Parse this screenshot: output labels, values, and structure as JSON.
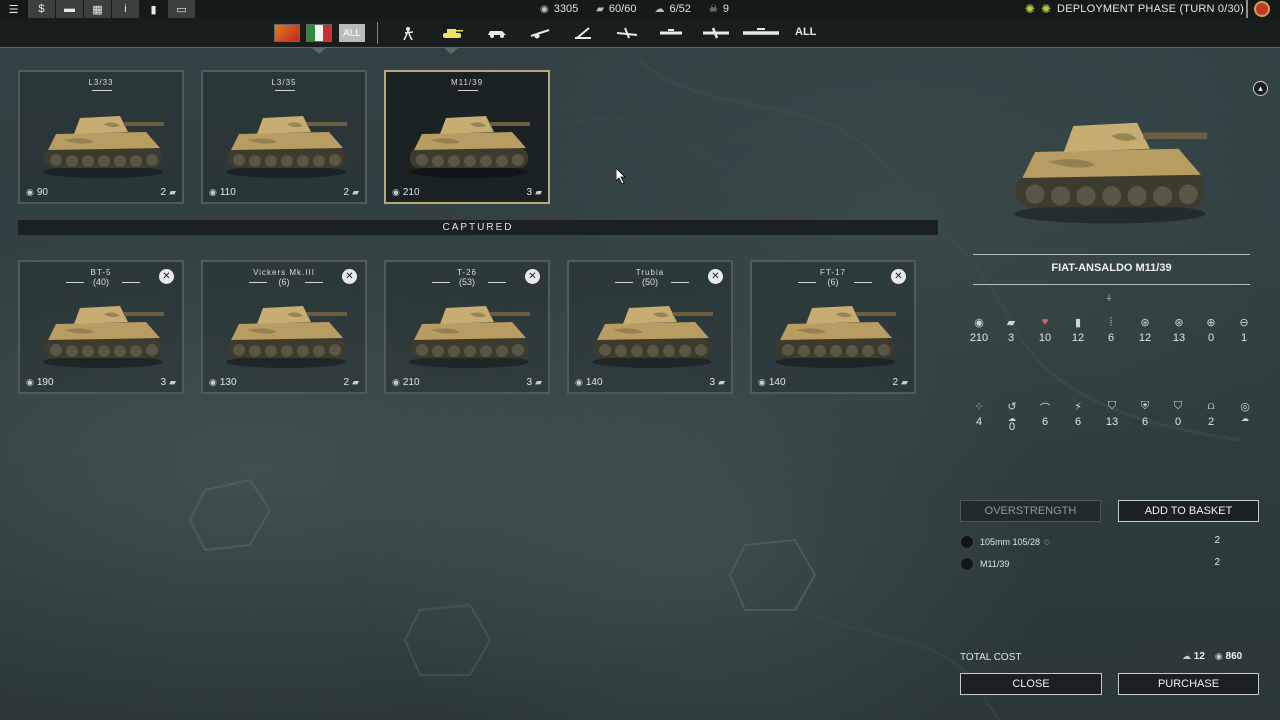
{
  "topbar": {
    "menu_icons": [
      "menu-icon",
      "money-icon",
      "chat-icon",
      "grid-icon",
      "info-icon",
      "stats-icon",
      "minimap-icon"
    ],
    "resources": [
      {
        "icon": "coins-icon",
        "value": "3305"
      },
      {
        "icon": "tank-slots-icon",
        "value": "60/60"
      },
      {
        "icon": "cloud-icon",
        "value": "6/52"
      },
      {
        "icon": "skull-icon",
        "value": "9"
      }
    ],
    "phase": "DEPLOYMENT PHASE (TURN 0/30)"
  },
  "filters": {
    "all_nations": "ALL",
    "all_categories": "ALL",
    "categories": [
      "infantry-icon",
      "tank-icon",
      "armored-car-icon",
      "artillery-icon",
      "anti-air-icon",
      "fighter-icon",
      "tactical-bomber-icon",
      "strategic-bomber-icon",
      "transport-plane-icon"
    ]
  },
  "units": [
    {
      "name": "L3/33",
      "cost": "90",
      "slots": "2"
    },
    {
      "name": "L3/35",
      "cost": "110",
      "slots": "2"
    },
    {
      "name": "M11/39",
      "cost": "210",
      "slots": "3"
    }
  ],
  "captured_label": "CAPTURED",
  "captured": [
    {
      "name": "BT-5",
      "count": "(40)",
      "cost": "190",
      "slots": "3"
    },
    {
      "name": "Vickers Mk.III",
      "count": "(6)",
      "cost": "130",
      "slots": "2"
    },
    {
      "name": "T-26",
      "count": "(53)",
      "cost": "210",
      "slots": "3"
    },
    {
      "name": "Trubia",
      "count": "(50)",
      "cost": "140",
      "slots": "3"
    },
    {
      "name": "FT-17",
      "count": "(6)",
      "cost": "140",
      "slots": "2"
    }
  ],
  "detail": {
    "title": "FIAT-ANSALDO M11/39",
    "stats_row1": [
      {
        "icon": "cost-icon",
        "value": "210"
      },
      {
        "icon": "slots-icon",
        "value": "3"
      },
      {
        "icon": "health-icon",
        "value": "10"
      },
      {
        "icon": "fuel-icon",
        "value": "12"
      },
      {
        "icon": "ammo-icon",
        "value": "6"
      },
      {
        "icon": "soft-attack-icon",
        "value": "12"
      },
      {
        "icon": "hard-attack-icon",
        "value": "13"
      },
      {
        "icon": "air-attack-icon",
        "value": "0"
      },
      {
        "icon": "naval-attack-icon",
        "value": "1"
      }
    ],
    "stats_row2": [
      {
        "icon": "movement-icon",
        "value": "4"
      },
      {
        "icon": "retreat-icon",
        "value": "0"
      },
      {
        "icon": "range-icon",
        "value": "6"
      },
      {
        "icon": "initiative-icon",
        "value": "6"
      },
      {
        "icon": "ground-defense-icon",
        "value": "13"
      },
      {
        "icon": "close-defense-icon",
        "value": "6"
      },
      {
        "icon": "air-defense-icon",
        "value": "0"
      },
      {
        "icon": "entrenchment-icon",
        "value": "2"
      },
      {
        "icon": "spotting-icon",
        "value": ""
      }
    ]
  },
  "buttons": {
    "overstrength": "OVERSTRENGTH",
    "add_to_basket": "ADD TO BASKET",
    "close": "CLOSE",
    "purchase": "PURCHASE"
  },
  "basket": [
    {
      "name": "105mm 105/28",
      "qty": "2"
    },
    {
      "name": "M11/39",
      "qty": "2"
    }
  ],
  "total": {
    "label": "TOTAL COST",
    "slots": "12",
    "cost": "860"
  }
}
